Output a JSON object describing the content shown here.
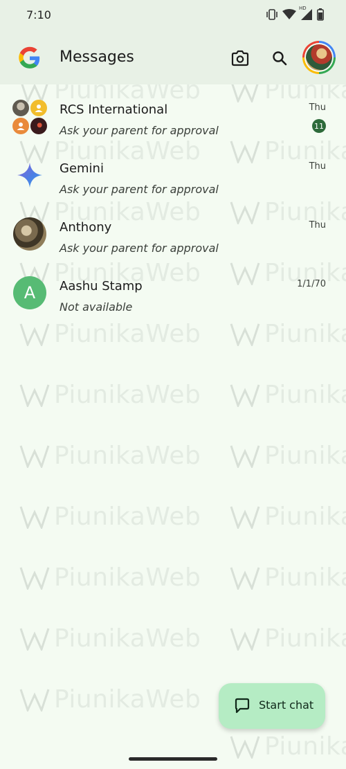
{
  "status_bar": {
    "time": "7:10",
    "network_label": "HD"
  },
  "app_bar": {
    "title": "Messages"
  },
  "conversations": [
    {
      "name": "RCS International",
      "snippet": "Ask your parent for approval",
      "time": "Thu",
      "unread": "11"
    },
    {
      "name": "Gemini",
      "snippet": "Ask your parent for approval",
      "time": "Thu"
    },
    {
      "name": "Anthony",
      "snippet": "Ask your parent for approval",
      "time": "Thu"
    },
    {
      "name": "Aashu Stamp",
      "snippet": "Not available",
      "time": "1/1/70",
      "initial": "A"
    }
  ],
  "fab": {
    "label": "Start chat"
  },
  "watermark": {
    "text": "PiunikaWeb"
  },
  "colors": {
    "background": "#f4fbf2",
    "app_bar": "#e8f1e6",
    "unread_badge": "#2d6a3a",
    "fab": "#b5ecc4",
    "letter_avatar": "#57bb74"
  },
  "icons": {
    "camera": "camera-icon",
    "search": "search-icon",
    "chat": "chat-bubble-icon"
  }
}
